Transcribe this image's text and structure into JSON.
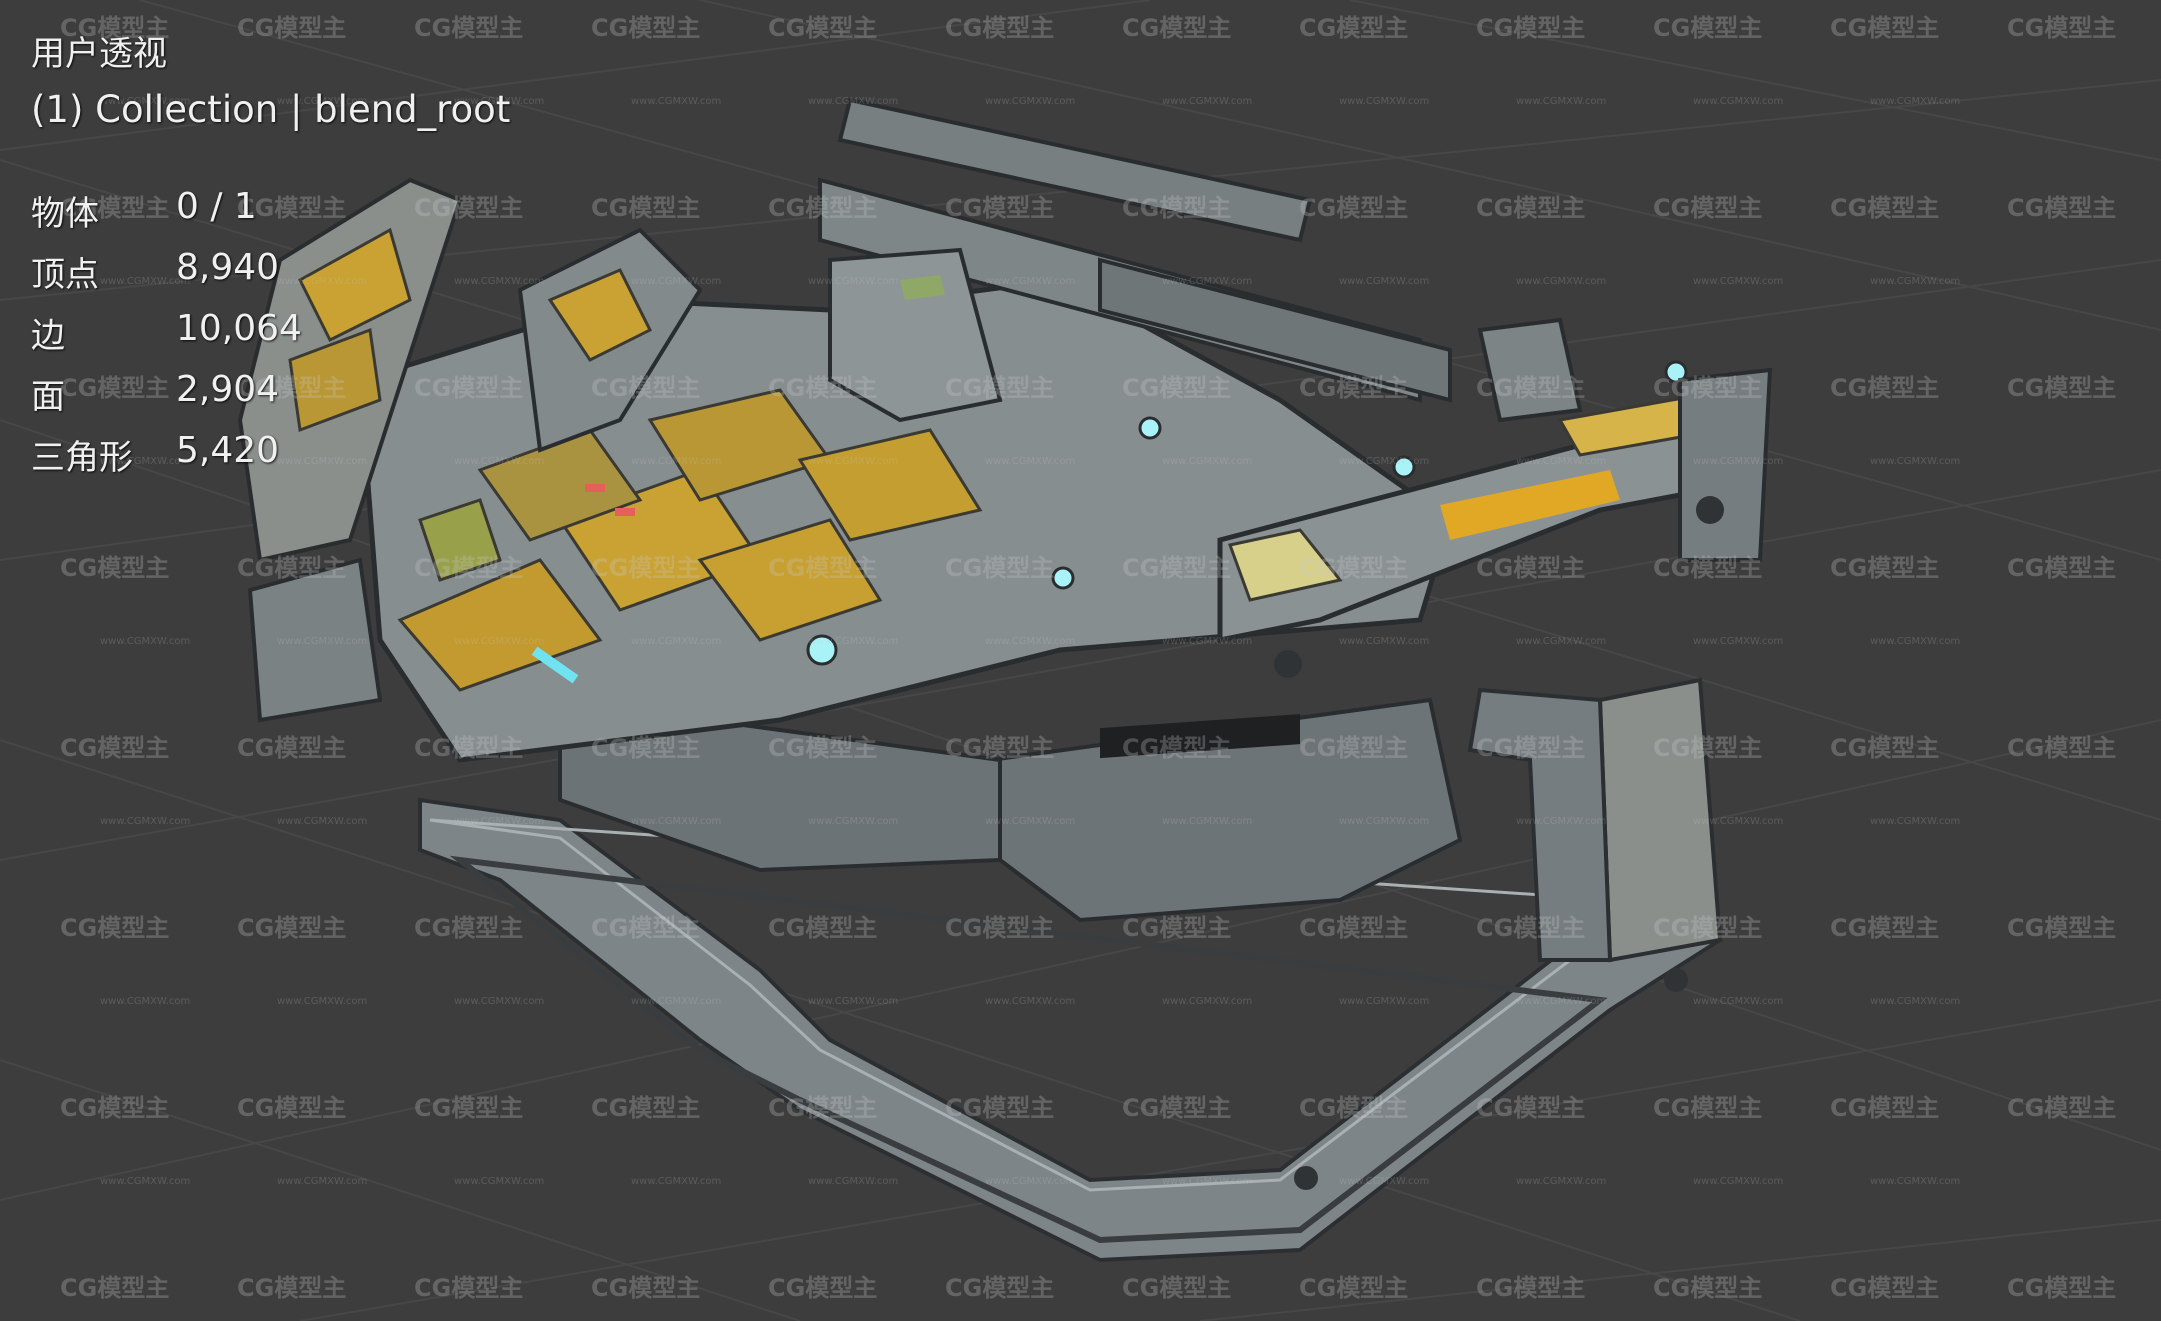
{
  "viewport": {
    "view_name": "用户透视",
    "collection_line": "(1) Collection | blend_root"
  },
  "stats": [
    {
      "label": "物体",
      "value": "0 / 1"
    },
    {
      "label": "顶点",
      "value": "8,940"
    },
    {
      "label": "边",
      "value": "10,064"
    },
    {
      "label": "面",
      "value": "2,904"
    },
    {
      "label": "三角形",
      "value": "5,420"
    }
  ],
  "watermark": {
    "text": "CG模型主",
    "small_text": "www.CGMXW.com"
  },
  "colors": {
    "background": "#3d3d3d",
    "grid_line": "#4a4a4a",
    "hull_gray": "#7e8588",
    "hull_yellow": "#c9a233",
    "hull_dark": "#3b3e40",
    "accent_cyan": "#6fe3f0"
  }
}
